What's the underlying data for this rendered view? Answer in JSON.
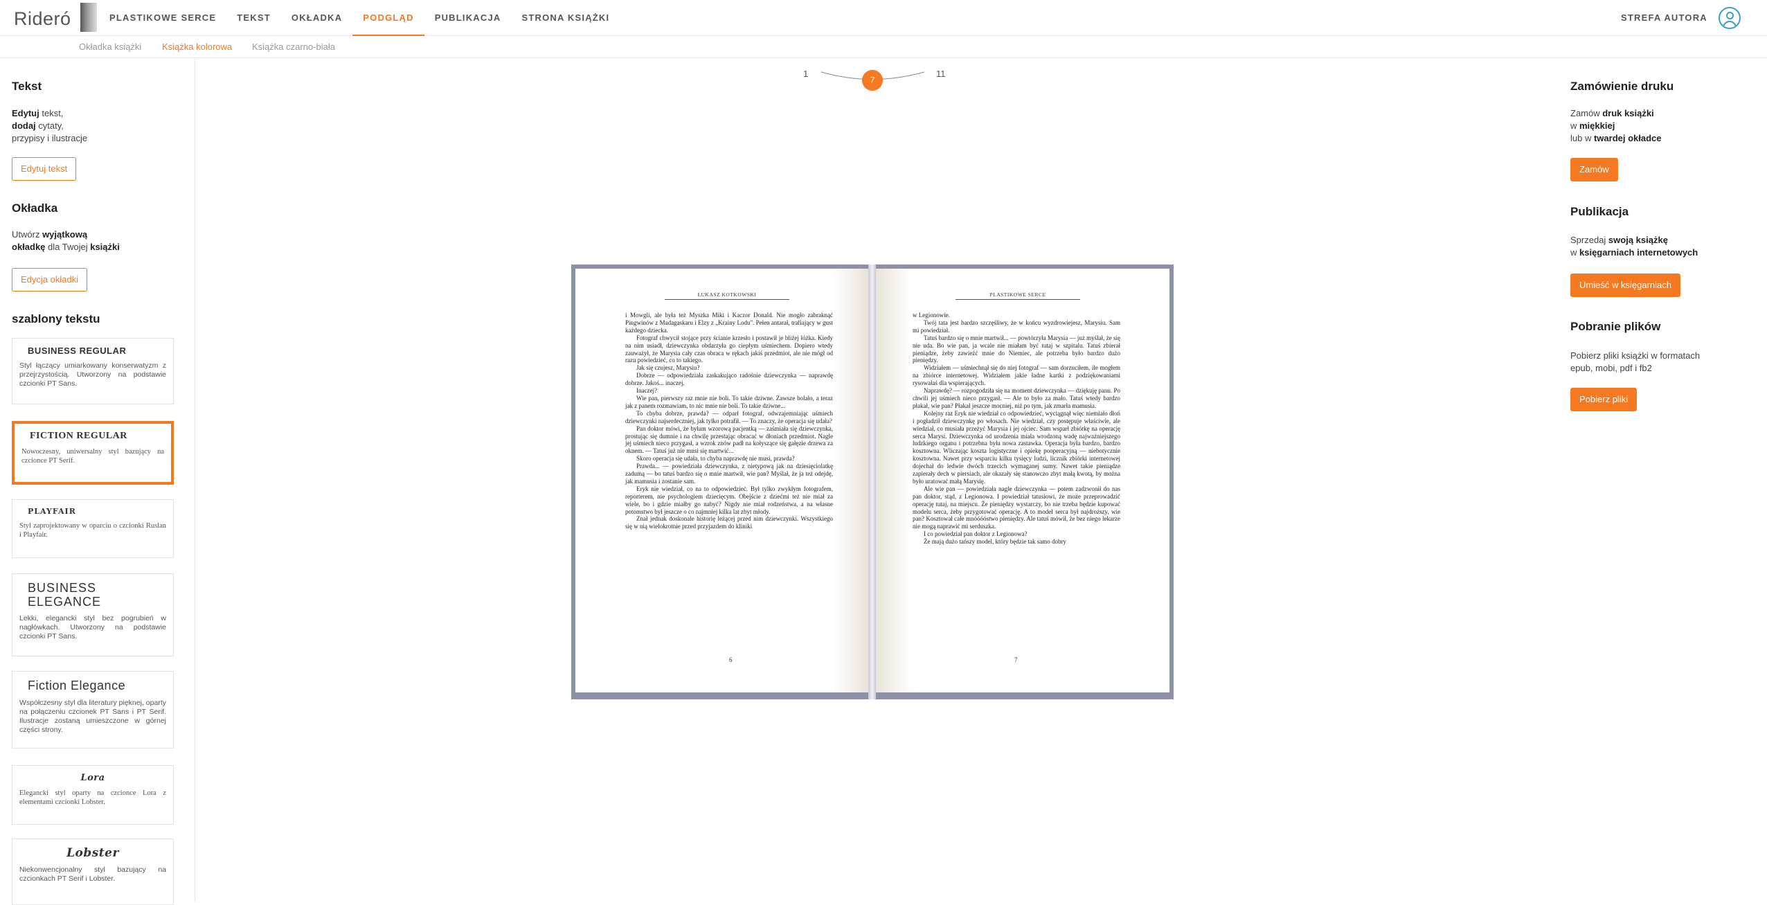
{
  "header": {
    "logo": "Rideró",
    "nav": [
      "PLASTIKOWE SERCE",
      "TEKST",
      "OKŁADKA",
      "PODGLĄD",
      "PUBLIKACJA",
      "STRONA KSIĄŻKI"
    ],
    "author_zone": "STREFA AUTORA"
  },
  "subnav": [
    "Okładka książki",
    "Książka kolorowa",
    "Książka czarno-biała"
  ],
  "left": {
    "text_title": "Tekst",
    "text_desc_1a": "Edytuj",
    "text_desc_1b": " tekst,",
    "text_desc_2a": "dodaj",
    "text_desc_2b": " cytaty,",
    "text_desc_3": "przypisy i ilustracje",
    "edit_text_btn": "Edytuj tekst",
    "cover_title": "Okładka",
    "cover_desc_1a": "Utwórz ",
    "cover_desc_1b": "wyjątkową",
    "cover_desc_2a": "okładkę",
    "cover_desc_2b": " dla Twojej ",
    "cover_desc_2c": "książki",
    "edit_cover_btn": "Edycja okładki",
    "templates_title": "szablony tekstu",
    "templates": [
      {
        "name": "BUSINESS REGULAR",
        "desc": "Styl łączący umiarkowany konserwatyzm z przejrzystością. Utworzony na podstawie czcionki PT Sans."
      },
      {
        "name": "FICTION REGULAR",
        "desc": "Nowoczesny, uniwersalny styl bazujący na czcionce PT Serif."
      },
      {
        "name": "PLAYFAIR",
        "desc": "Styl zaprojektowany w oparciu o czcionki Ruslan i Playfair."
      },
      {
        "name": "BUSINESS ELEGANCE",
        "desc": "Lekki, elegancki styl bez pogrubień w nagłówkach. Utworzony na podstawie czcionki PT Sans."
      },
      {
        "name": "Fiction Elegance",
        "desc": "Współczesny styl dla literatury pięknej, oparty na połączeniu czcionek PT Sans i PT Serif. Ilustracje zostaną umieszczone w górnej części strony."
      },
      {
        "name": "Lora",
        "desc": "Elegancki styl oparty na czcionce Lora z elementami czcionki Lobster."
      },
      {
        "name": "Lobster",
        "desc": "Niekonwencjonalny styl bazujący na czcionkach PT Serif i Lobster."
      }
    ]
  },
  "pager": {
    "first": "1",
    "current": "7",
    "last": "11"
  },
  "book": {
    "left_head": "ŁUKASZ KOTKOWSKI",
    "right_head": "PLASTIKOWE SERCE",
    "left_num": "6",
    "right_num": "7",
    "left_paragraphs": [
      "i Mowgli, ale była też Myszka Miki i Kaczor Donald. Nie mogło zabraknąć Pingwinów z Madagaskaru i Elzy z „Krainy Lodu\". Pełen antarał, trafiający w gust każdego dziecka.",
      "Fotograf chwycił stojące przy ścianie krzesło i postawił je bliżej łóżka. Kiedy na nim usiadł, dziewczynka obdarzyła go ciepłym uśmiechem. Dopiero wtedy zauważył, że Marysia cały czas obraca w rękach jakiś przedmiot, ale nie mógł od razu powiedzieć, co to takiego.",
      "Jak się czujesz, Marysiu?",
      "Dobrze — odpowiedziała zaskakująco radośnie dziewczynka — naprawdę dobrze. Jakoś... inaczej.",
      "Inaczej?",
      "Wie pan, pierwszy raz mnie nie boli. To takie dziwne. Zawsze bolało, a teraz jak z panem rozmawiam, to nic mnie nie boli. To takie dziwne...",
      "To chyba dobrze, prawda? — odparł fotograf, odwzajemniając uśmiech dziewczynki najserdeczniej, jak tylko potrafił. — To znaczy, że operacja się udała?",
      "Pan doktor mówi, że byłam wzorową pacjentką — zaśmiała się dziewczynka, prostując się dumnie i na chwilę przestając obracać w dłoniach przedmiot. Nagle jej uśmiech nieco przygasł, a wzrok znów padł na kołyszące się gałęzie drzewa za oknem. — Tatuś już nie musi się martwić...",
      "Skoro operacja się udała, to chyba naprawdę nie musi, prawda?",
      "Prawda... — powiedziała dziewczynka, z nietypową jak na dziesięciolatkę zadumą — bo tatuś bardzo się o mnie martwił, wie pan? Myślał, że ja też odejdę, jak mamusia i zostanie sam.",
      "Eryk nie wiedział, co na to odpowiedzieć. Był tylko zwykłym fotografem, reporterem, nie psychologiem dziecięcym. Obejście z dziećmi też nie miał za wiele, bo i gdzie miałby go nabyć? Nigdy nie miał rodzeństwa, a na własne potomstwo był jeszcze o co najmniej kilka lat zbyt młody.",
      "Znał jednak doskonale historię leżącej przed nim dziewczynki. Wszystkiego się w nią wielokrotnie przed przyjazdem do kliniki"
    ],
    "right_paragraphs": [
      "w Legionowie.",
      "Twój tata jest bardzo szczęśliwy, że w końcu wyzdrowiejesz, Marysiu. Sam mi powiedział.",
      "Tatuś bardzo się o mnie martwił... — powtórzyła Marysia — już myślał, że się nie uda. Bo wie pan, ja wcale nie miałam być tutaj w szpitalu. Tatuś zbierał pieniądze, żeby zawieźć mnie do Niemiec, ale potrzeba było bardzo dużo pieniędzy.",
      "Widziałem — uśmiechnął się do niej fotograf — sam dorzuciłem, ile mogłem na zbiórce internetowej. Widziałem jakie ładne kartki z podziękowaniami rysowałaś dla wspierających.",
      "Naprawdę? — rozpogodziła się na moment dziewczynka — dziękuję panu. Po chwili jej uśmiech nieco przygasł. — Ale to było za mało. Tatuś wtedy bardzo płakał, wie pan? Płakał jeszcze mocniej, niż po tym, jak zmarła mamusia.",
      "Kolejny raz Eryk nie wiedział co odpowiedzieć, wyciągnął więc niemiało dłoń i pogładził dziewczynkę po włosach. Nie wiedział, czy postępuje właściwie, ale wiedział, co musiała przeżyć Marysia i jej ojciec. Sam wsparł zbiórkę na operację serca Marysi. Dziewczynka od urodzenia miała wrodzoną wadę najważniejszego ludzkiego organu i potrzebna była nowa zastawka. Operacja była bardzo, bardzo kosztowna. Wliczając koszta logistyczne i opiekę pooperacyjną — niebotycznie kosztowna. Nawet przy wsparciu kilku tysięcy ludzi, licznik zbiórki internetowej dojechał do ledwie dwóch trzecich wymaganej sumy. Nawet takie pieniądze zapierały dech w piersiach, ale okazały się stanowczo zbyt małą kwotą, by można było uratować małą Marysię.",
      "Ale wie pan — powiedziała nagle dziewczynka — potem zadzwonił do nas pan doktor, stąd, z Legionowa. I powiedział tatusiowi, że może przeprowadzić operację tutaj, na miejscu. Że pieniędzy wystarczy, bo nie trzeba będzie kupować modelu serca, żeby przygotować operację. A to model serca był najdroższy, wie pan? Kosztował całe mnóóóóstwo pieniędzy. Ale tatuś mówił, że bez niego lekarze nie mogą naprawić mi serduszka.",
      "I co powiedział pan doktor z Legionowa?",
      "Że mają dużo tańszy model, który będzie tak samo dobry"
    ]
  },
  "right": {
    "order_title": "Zamówienie druku",
    "order_desc_1a": "Zamów ",
    "order_desc_1b": "druk książki",
    "order_desc_2a": "w ",
    "order_desc_2b": "miękkiej",
    "order_desc_3a": "lub w ",
    "order_desc_3b": "twardej okładce",
    "order_btn": "Zamów",
    "pub_title": "Publikacja",
    "pub_desc_1a": "Sprzedaj ",
    "pub_desc_1b": "swoją książkę",
    "pub_desc_2a": "w ",
    "pub_desc_2b": "księgarniach internetowych",
    "pub_btn": "Umieść w księgarniach",
    "dl_title": "Pobranie plików",
    "dl_desc_1": "Pobierz pliki książki w formatach",
    "dl_desc_2": "epub, mobi, pdf i fb2",
    "dl_btn": "Pobierz pliki"
  }
}
